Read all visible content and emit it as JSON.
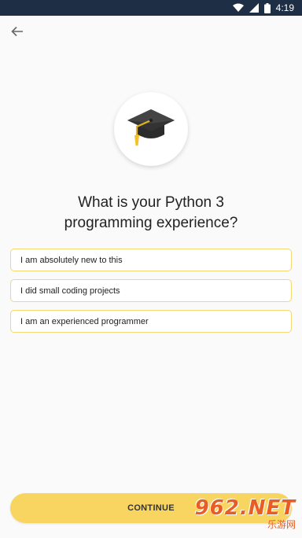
{
  "status_bar": {
    "time": "4:19"
  },
  "question": {
    "line1": "What is your Python 3",
    "line2": "programming experience?"
  },
  "options": [
    {
      "label": "I am absolutely new to this"
    },
    {
      "label": "I did small coding projects"
    },
    {
      "label": "I am an experienced programmer"
    }
  ],
  "continue_label": "CONTINUE",
  "watermark": {
    "main": "962.NET",
    "sub": "乐游网"
  },
  "colors": {
    "status_bar": "#1e2f45",
    "accent": "#f7d560",
    "option_border": "#f3d774"
  },
  "icons": {
    "back": "arrow-left-icon",
    "hero": "graduation-cap-icon"
  }
}
